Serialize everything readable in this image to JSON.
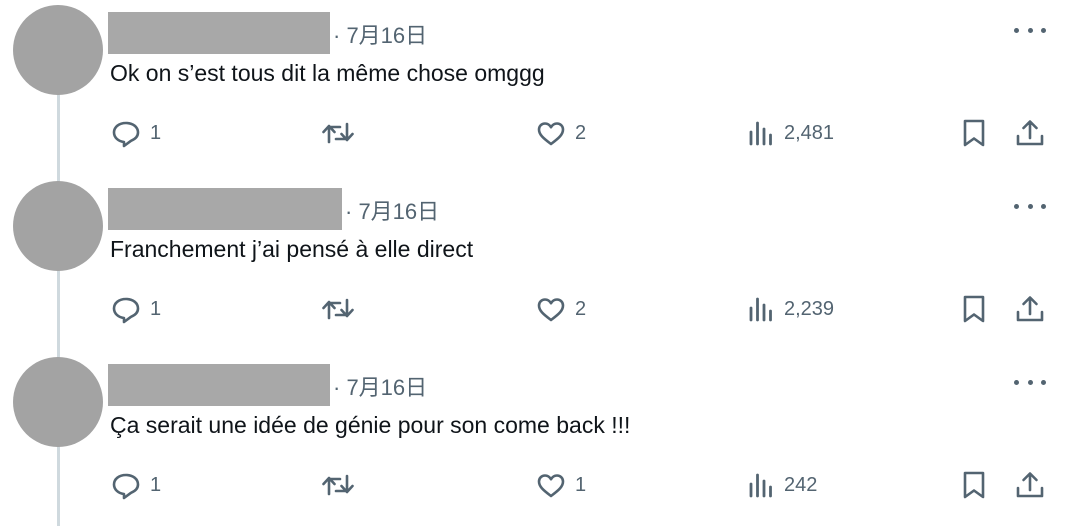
{
  "replies": [
    {
      "date": "· 7月16日",
      "text": "Ok on s’est tous dit la même chose omggg",
      "reply_count": "1",
      "like_count": "2",
      "view_count": "2,481"
    },
    {
      "date": "· 7月16日",
      "text": "Franchement j’ai pensé à elle direct",
      "reply_count": "1",
      "like_count": "2",
      "view_count": "2,239"
    },
    {
      "date": "· 7月16日",
      "text": "Ça serait une idée de génie pour son come back !!!",
      "reply_count": "1",
      "like_count": "1",
      "view_count": "242"
    }
  ],
  "icons": {
    "reply": "speech-bubble-icon",
    "retweet": "retweet-arrows-icon",
    "like": "heart-icon",
    "views": "bar-chart-icon",
    "bookmark": "bookmark-icon",
    "share": "share-upload-icon",
    "more": "ellipsis-icon"
  },
  "colors": {
    "text": "#0f1419",
    "muted": "#536471",
    "redaction": "#a8a8a8",
    "avatar": "#a3a3a3",
    "thread_line": "#cfd9de"
  }
}
